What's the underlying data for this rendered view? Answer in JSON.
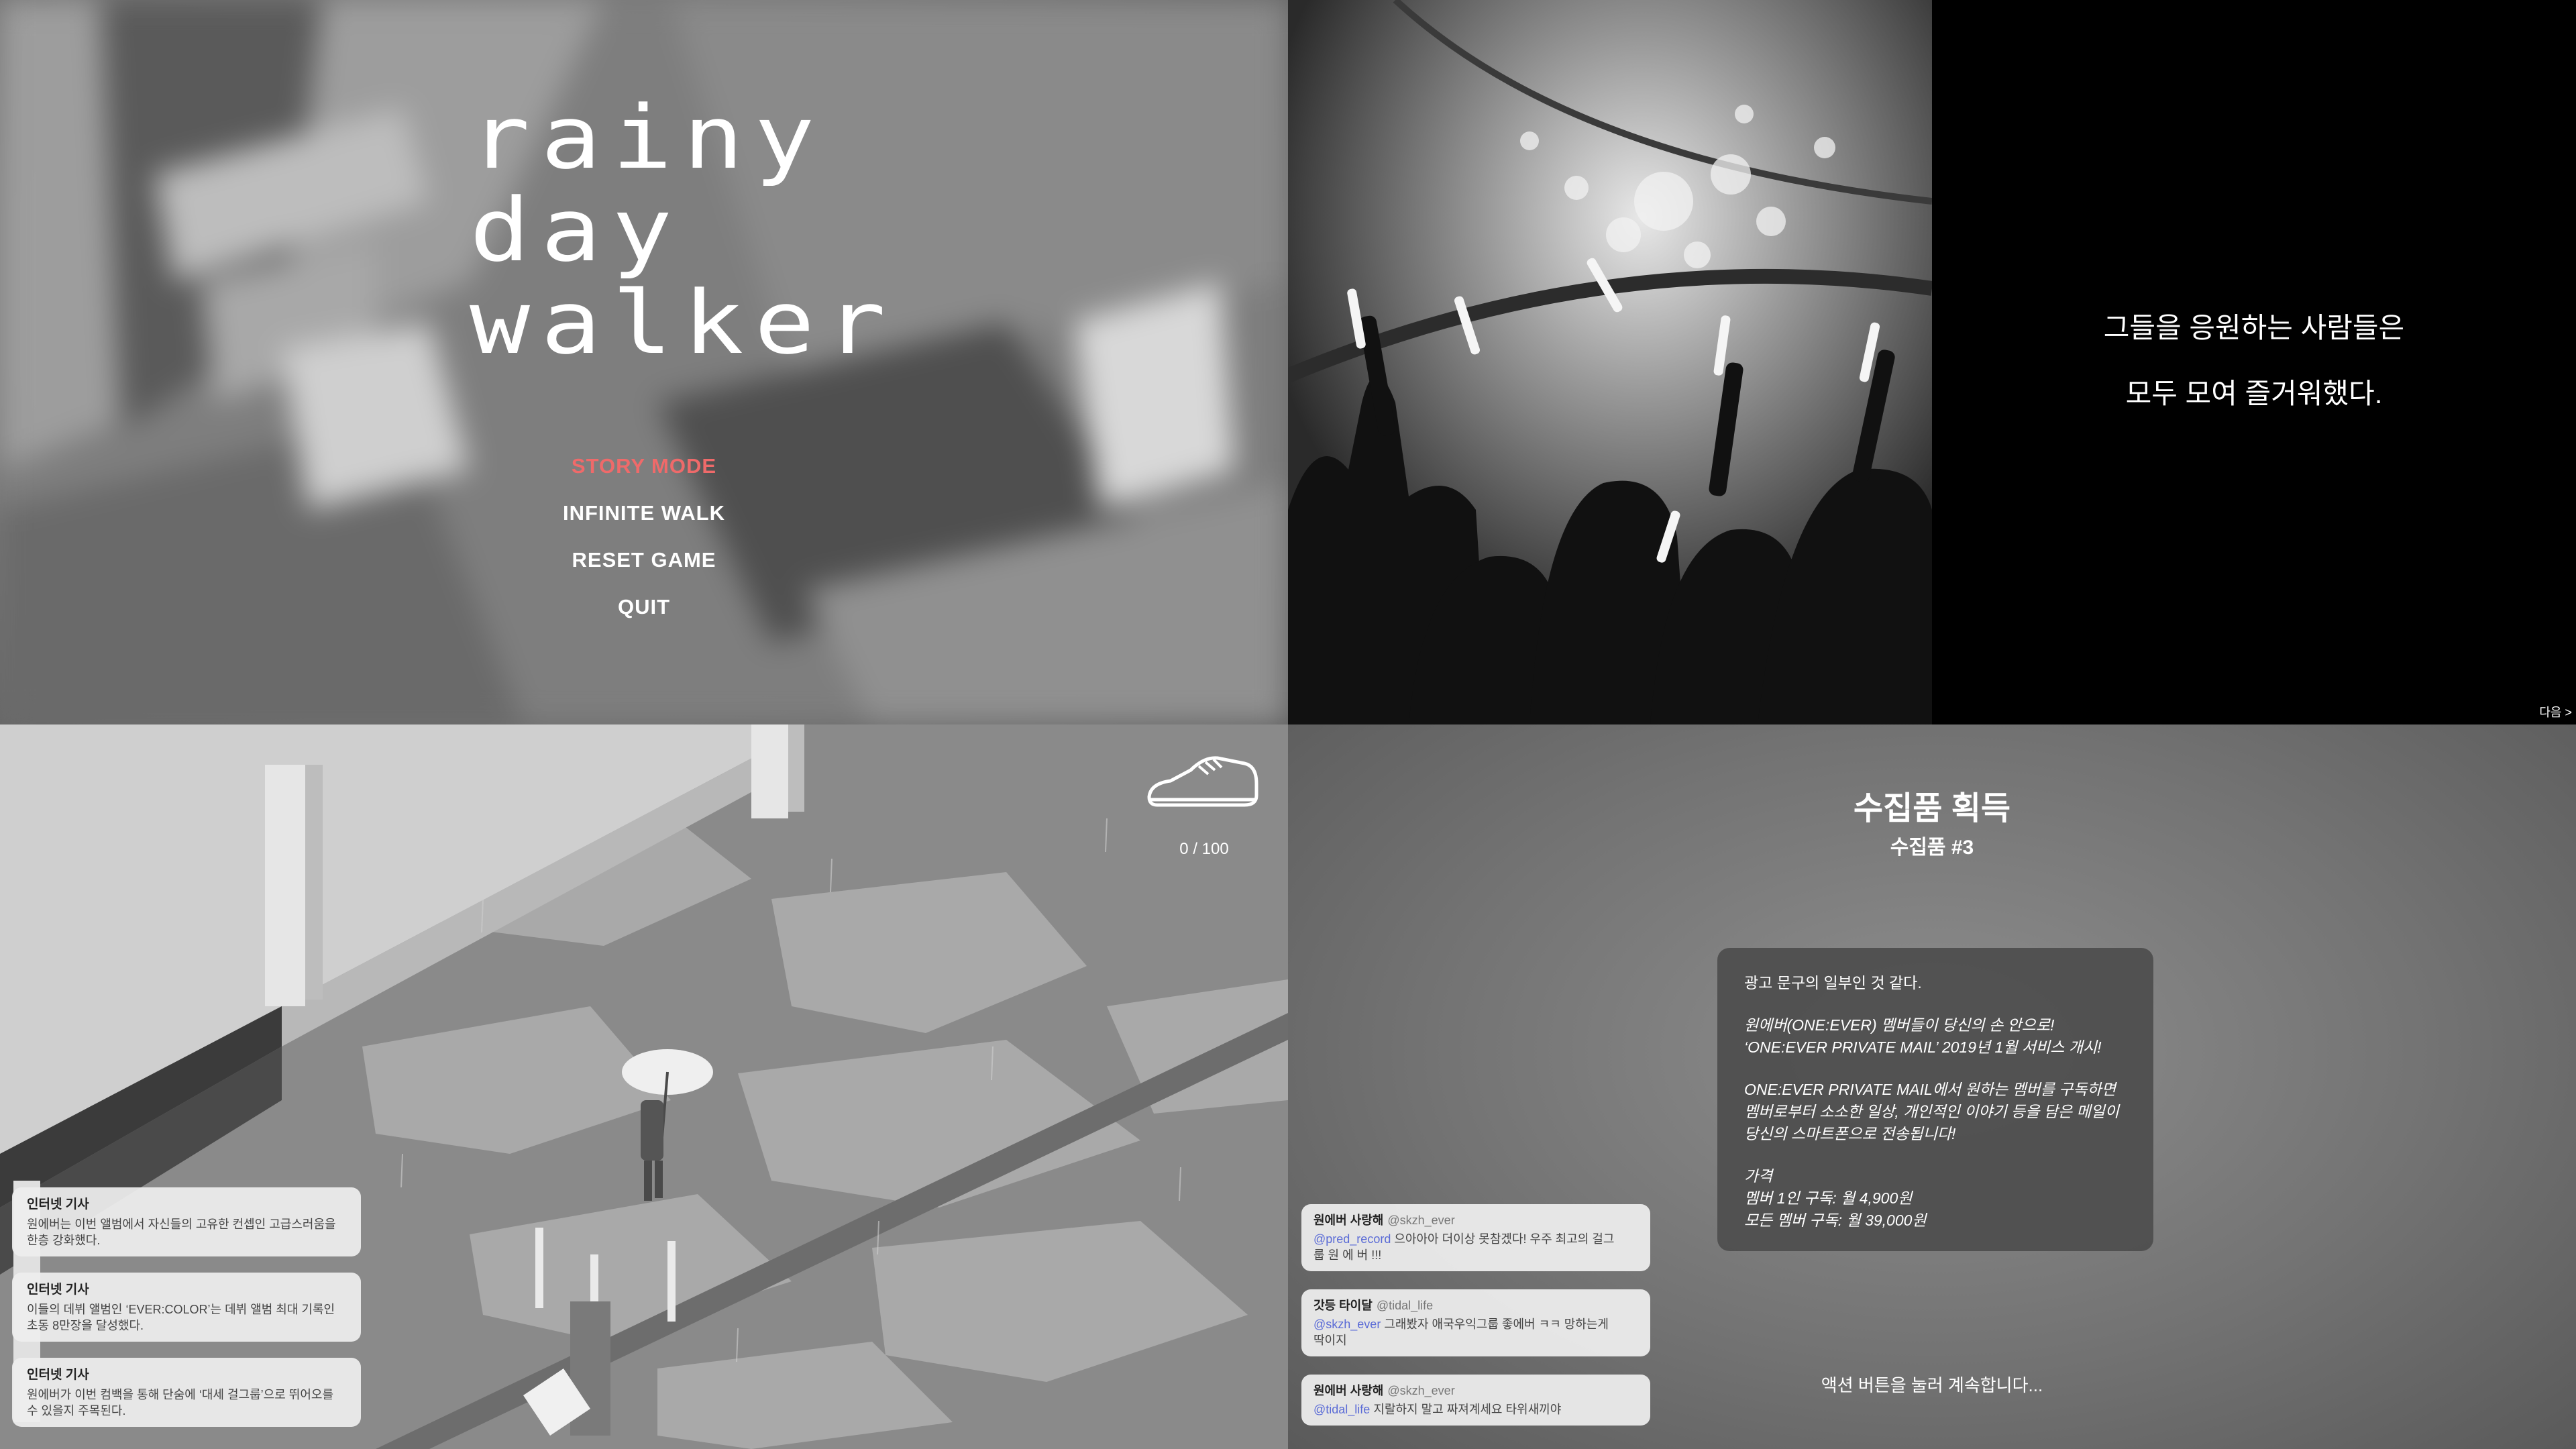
{
  "title_screen": {
    "logo_lines": [
      "rainy",
      "day",
      "walker"
    ],
    "menu": [
      {
        "label": "STORY MODE",
        "active": true
      },
      {
        "label": "INFINITE WALK",
        "active": false
      },
      {
        "label": "RESET GAME",
        "active": false
      },
      {
        "label": "QUIT",
        "active": false
      }
    ],
    "active_color": "#ef6a6a"
  },
  "cutscene": {
    "caption_lines": [
      "그들을 응원하는 사람들은",
      "모두 모여 즐거워했다."
    ],
    "next_label": "다음 >"
  },
  "gameplay": {
    "steps_label": "0 / 100",
    "shoe_icon": "shoe-icon",
    "news": [
      {
        "heading": "인터넷 기사",
        "lines": [
          "원에버는 이번 앨범에서 자신들의 고유한 컨셉인 고급스러움을",
          "한층 강화했다."
        ]
      },
      {
        "heading": "인터넷 기사",
        "lines": [
          "이들의 데뷔 앨범인 ‘EVER:COLOR’는 데뷔 앨범 최대 기록인",
          "초동 8만장을 달성했다."
        ]
      },
      {
        "heading": "인터넷 기사",
        "lines": [
          "원에버가 이번 컴백을 통해 단숨에 ‘대세 걸그룹’으로 뛰어오를",
          "수 있을지 주목된다."
        ]
      }
    ]
  },
  "collectible": {
    "title": "수집품 획득",
    "subtitle": "수집품 #3",
    "card": {
      "intro": "광고 문구의 일부인 것 같다.",
      "para1": [
        "원에버(ONE:EVER) 멤버들이 당신의 손 안으로!",
        "‘ONE:EVER PRIVATE MAIL’ 2019년 1월 서비스 개시!"
      ],
      "para2": [
        "ONE:EVER PRIVATE MAIL에서 원하는 멤버를 구독하면",
        "멤버로부터 소소한 일상, 개인적인 이야기 등을 담은 메일이",
        "당신의 스마트폰으로 전송됩니다!"
      ],
      "para3": [
        "가격",
        "멤버 1인 구독: 월 4,900원",
        "모든 멤버 구독: 월 39,000원"
      ]
    },
    "continue_label": "액션 버튼을 눌러 계속합니다...",
    "chats": [
      {
        "name": "원에버 사랑해",
        "handle": "@skzh_ever",
        "mention": "@pred_record",
        "text": " 으아아아 더이상 못참겠다! 우주 최고의 걸그",
        "text2": "룹 원 에 버 !!!"
      },
      {
        "name": "갓등 타이달",
        "handle": "@tidal_life",
        "mention": "@skzh_ever",
        "text": " 그래봤자 애국우익그룹 좋에버 ㅋㅋ 망하는게",
        "text2": "딱이지"
      },
      {
        "name": "원에버 사랑해",
        "handle": "@skzh_ever",
        "mention": "@tidal_life",
        "text": " 지랄하지 말고 짜져계세요 타위새끼야",
        "text2": ""
      }
    ]
  }
}
